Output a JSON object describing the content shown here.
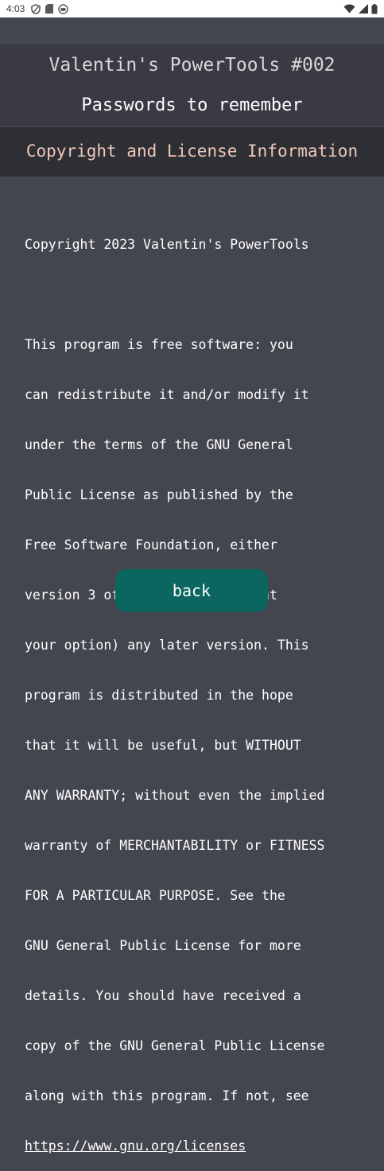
{
  "status_bar": {
    "time": "4:03",
    "icons_left": [
      "shield-icon",
      "sd-card-icon",
      "record-icon"
    ],
    "icons_right": [
      "wifi-icon",
      "signal-icon",
      "battery-icon"
    ]
  },
  "header": {
    "app_title": "Valentin's PowerTools #002",
    "page_title": "Passwords to remember"
  },
  "section": {
    "title": "Copyright and License Information"
  },
  "license": {
    "copyright_line": "Copyright 2023 Valentin's PowerTools",
    "body_lines": [
      "This program is free software: you",
      "can redistribute it and/or modify it",
      "under the terms of the GNU General",
      "Public License as published by the",
      "Free Software Foundation, either",
      "version 3 of the License, or (at",
      "your option) any later version. This",
      "program is distributed in the hope",
      "that it will be useful, but WITHOUT",
      "ANY WARRANTY; without even the implied",
      "warranty of MERCHANTABILITY or FITNESS",
      "FOR A PARTICULAR PURPOSE. See the",
      "GNU General Public License for more",
      "details. You should have received a",
      "copy of the GNU General Public License",
      "along with this program. If not, see"
    ],
    "link": "https://www.gnu.org/licenses"
  },
  "actions": {
    "back_label": "back"
  },
  "colors": {
    "background": "#44464f",
    "header_bg": "#393a44",
    "section_bg": "#2e2f35",
    "section_title": "#f0c8b8",
    "button_bg": "#0b6660"
  }
}
